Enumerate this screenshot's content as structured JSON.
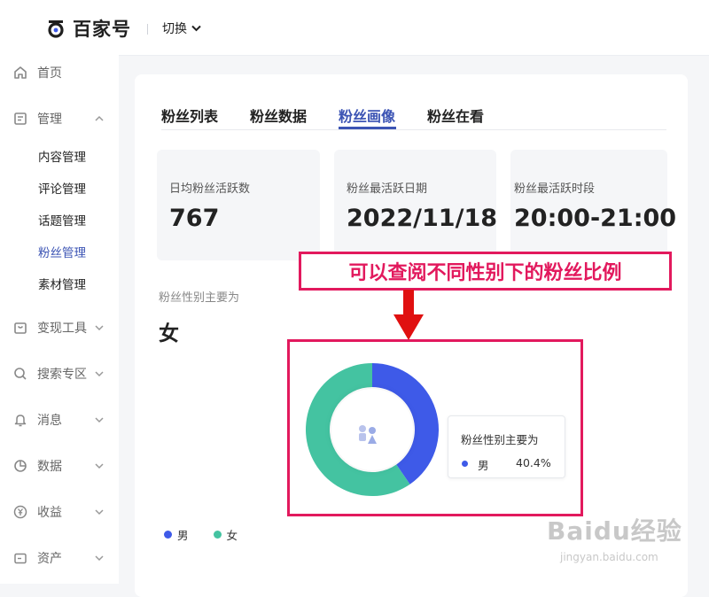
{
  "header": {
    "logo_text": "百家号",
    "switch_label": "切换"
  },
  "sidebar": {
    "items": [
      {
        "label": "首页",
        "icon": "home-icon"
      },
      {
        "label": "管理",
        "icon": "document-icon"
      },
      {
        "label": "变现工具",
        "icon": "bag-icon"
      },
      {
        "label": "搜索专区",
        "icon": "search-icon"
      },
      {
        "label": "消息",
        "icon": "bell-icon"
      },
      {
        "label": "数据",
        "icon": "pie-chart-icon"
      },
      {
        "label": "收益",
        "icon": "yen-icon"
      },
      {
        "label": "资产",
        "icon": "wallet-icon"
      }
    ],
    "management_sub": [
      "内容管理",
      "评论管理",
      "话题管理",
      "粉丝管理",
      "素材管理"
    ]
  },
  "tabs": [
    "粉丝列表",
    "粉丝数据",
    "粉丝画像",
    "粉丝在看"
  ],
  "active_tab": "粉丝画像",
  "stats": [
    {
      "label": "日均粉丝活跃数",
      "value": "767"
    },
    {
      "label": "粉丝最活跃日期",
      "value": "2022/11/18"
    },
    {
      "label": "粉丝最活跃时段",
      "value": "20:00-21:00"
    }
  ],
  "gender": {
    "label": "粉丝性别主要为",
    "value": "女"
  },
  "annotation": {
    "text": "可以查阅不同性别下的粉丝比例"
  },
  "tooltip": {
    "title": "粉丝性别主要为",
    "name": "男",
    "value": "40.4%"
  },
  "chart_data": {
    "type": "pie",
    "categories": [
      "男",
      "女"
    ],
    "values": [
      40.4,
      59.6
    ],
    "colors": [
      "#3e5ae8",
      "#44c3a1"
    ],
    "legend_position": "bottom-left"
  },
  "watermark": {
    "main": "Baidu经验",
    "sub": "jingyan.baidu.com"
  },
  "colors": {
    "accent": "#3c54b4",
    "annotation": "#e2195d"
  }
}
